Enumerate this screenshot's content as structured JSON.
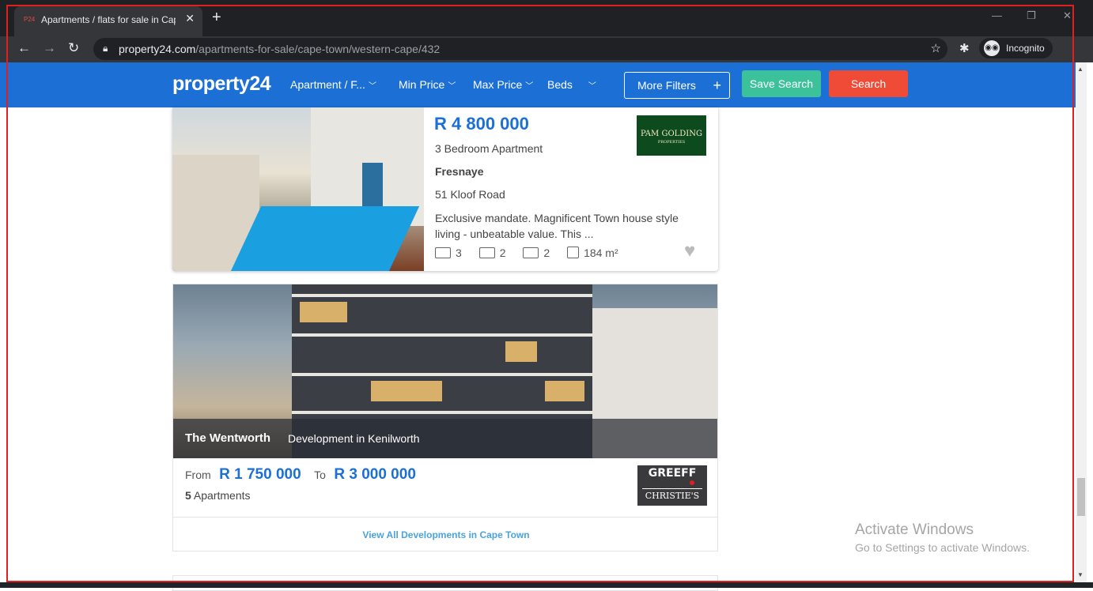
{
  "browser": {
    "tab_title": "Apartments / flats for sale in Cape Town",
    "tab_close": "✕",
    "new_tab": "+",
    "url_domain": "property24.com",
    "url_path": "/apartments-for-sale/cape-town/western-cape/432",
    "incognito_label": "Incognito",
    "win_minimize": "—",
    "win_restore": "❐",
    "win_close": "✕"
  },
  "site": {
    "logo": "property24",
    "nav": [
      "Apartment / F...",
      "Min Price",
      "Max Price",
      "Beds"
    ],
    "more_filters": "More Filters",
    "save_search": "Save Search",
    "search": "Search",
    "colors": {
      "brand": "#1c6fd4",
      "save": "#3cc29a",
      "search": "#f04b37"
    }
  },
  "listing": {
    "price": "R 4 800 000",
    "type": "3 Bedroom Apartment",
    "suburb": "Fresnaye",
    "address": "51 Kloof Road",
    "description": "Exclusive mandate. Magnificent Town house style living - unbeatable value. This ...",
    "beds": "3",
    "baths": "2",
    "garages": "2",
    "size": "184 m²",
    "agency": "PAM GOLDING",
    "agency_sub": "PROPERTIES"
  },
  "development": {
    "name": "The Wentworth",
    "subtitle": "Development in Kenilworth",
    "from_label": "From",
    "from_price": "R 1 750 000",
    "to_label": "To",
    "to_price": "R 3 000 000",
    "units_count": "5",
    "units_label": " Apartments",
    "agency_line1": "GREEFF",
    "agency_line2": "CHRISTIE'S",
    "view_all": "View All Developments in Cape Town"
  },
  "watermark": {
    "line1": "Activate Windows",
    "line2": "Go to Settings to activate Windows."
  }
}
